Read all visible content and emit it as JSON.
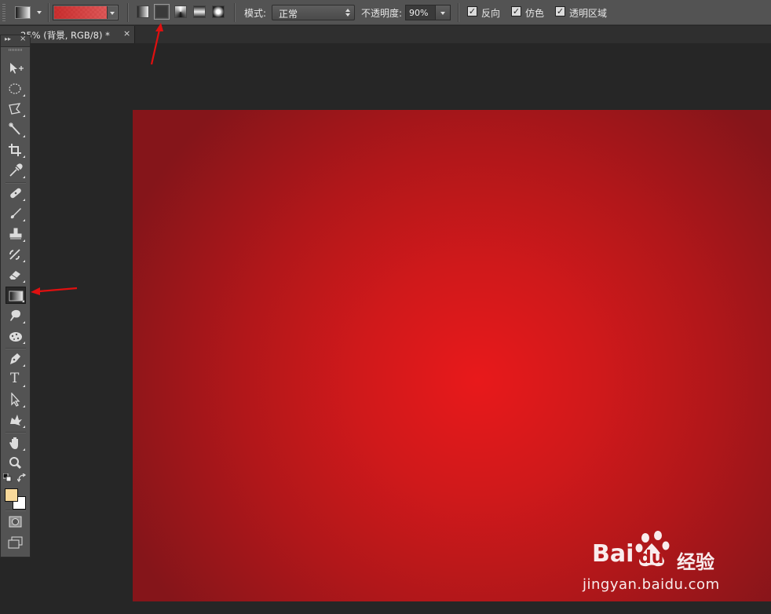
{
  "options_bar": {
    "mode_label": "模式:",
    "mode_value": "正常",
    "opacity_label": "不透明度:",
    "opacity_value": "90%",
    "reverse_label": "反向",
    "dither_label": "仿色",
    "transparency_label": "透明区域",
    "reverse_checked": true,
    "dither_checked": true,
    "transparency_checked": true,
    "active_gradient_type": "radial",
    "gradient_color": "#c92222"
  },
  "document": {
    "tab_title": "25% (背景, RGB/8) *",
    "close_glyph": "×"
  },
  "toolbox": {
    "head_collapse": "▸▸",
    "head_close": "×",
    "active_tool": "gradient-tool",
    "foreground_color": "#f8d99a",
    "background_color": "#ffffff",
    "type_tool_glyph": "T"
  },
  "canvas": {
    "center_color": "#e8191b",
    "edge_color": "#85151a"
  },
  "watermark": {
    "brand_left": "Bai",
    "brand_right": "du",
    "jingyan": "经验",
    "url": "jingyan.baidu.com"
  },
  "annotation_color": "#e01010"
}
